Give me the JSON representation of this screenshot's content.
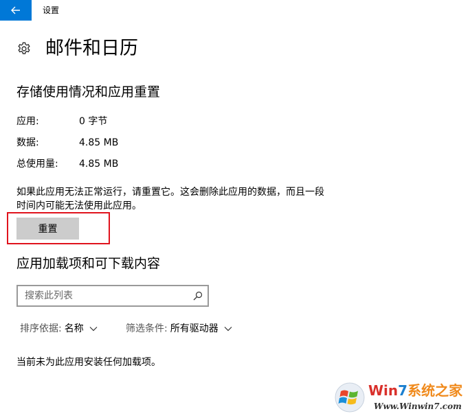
{
  "titlebar": {
    "title": "设置"
  },
  "page": {
    "title": "邮件和日历"
  },
  "storage": {
    "heading": "存储使用情况和应用重置",
    "rows": [
      {
        "label": "应用:",
        "value": "0 字节"
      },
      {
        "label": "数据:",
        "value": "4.85 MB"
      },
      {
        "label": "总使用量:",
        "value": "4.85 MB"
      }
    ],
    "description": "如果此应用无法正常运行，请重置它。这会删除此应用的数据，而且一段时间内可能无法使用此应用。",
    "reset_label": "重置"
  },
  "addons": {
    "heading": "应用加载项和可下载内容",
    "search_placeholder": "搜索此列表",
    "sort_label": "排序依据:",
    "sort_value": "名称",
    "filter_label": "筛选条件:",
    "filter_value": "所有驱动器",
    "empty_message": "当前未为此应用安装任何加载项。"
  },
  "watermark": {
    "brand_part1": "Win",
    "brand_part2": "7",
    "brand_part3": "系统之家",
    "url": "Www.Winwin7.com"
  },
  "colors": {
    "accent": "#0078d7",
    "highlight": "#e0121c",
    "button_bg": "#cccccc"
  },
  "icons": [
    "back-arrow-icon",
    "gear-icon",
    "search-icon",
    "chevron-down-icon",
    "windows-logo-icon"
  ]
}
